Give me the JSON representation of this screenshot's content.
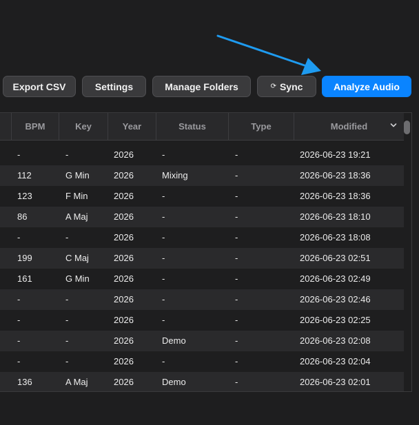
{
  "toolbar": {
    "export_csv": "Export CSV",
    "settings": "Settings",
    "manage_folders": "Manage Folders",
    "sync_icon": "⟳",
    "sync": "Sync",
    "analyze_audio": "Analyze Audio"
  },
  "table": {
    "columns": [
      "BPM",
      "Key",
      "Year",
      "Status",
      "Type",
      "Modified"
    ],
    "sort_icon": "chevron-down-icon",
    "rows": [
      {
        "bpm": "-",
        "key": "-",
        "year": "2026",
        "status": "-",
        "type": "-",
        "modified": "2026-06-23 19:21"
      },
      {
        "bpm": "112",
        "key": "G Min",
        "year": "2026",
        "status": "Mixing",
        "type": "-",
        "modified": "2026-06-23 18:36"
      },
      {
        "bpm": "123",
        "key": "F Min",
        "year": "2026",
        "status": "-",
        "type": "-",
        "modified": "2026-06-23 18:36"
      },
      {
        "bpm": "86",
        "key": "A Maj",
        "year": "2026",
        "status": "-",
        "type": "-",
        "modified": "2026-06-23 18:10"
      },
      {
        "bpm": "-",
        "key": "-",
        "year": "2026",
        "status": "-",
        "type": "-",
        "modified": "2026-06-23 18:08"
      },
      {
        "bpm": "199",
        "key": "C Maj",
        "year": "2026",
        "status": "-",
        "type": "-",
        "modified": "2026-06-23 02:51"
      },
      {
        "bpm": "161",
        "key": "G Min",
        "year": "2026",
        "status": "-",
        "type": "-",
        "modified": "2026-06-23 02:49"
      },
      {
        "bpm": "-",
        "key": "-",
        "year": "2026",
        "status": "-",
        "type": "-",
        "modified": "2026-06-23 02:46"
      },
      {
        "bpm": "-",
        "key": "-",
        "year": "2026",
        "status": "-",
        "type": "-",
        "modified": "2026-06-23 02:25"
      },
      {
        "bpm": "-",
        "key": "-",
        "year": "2026",
        "status": "Demo",
        "type": "-",
        "modified": "2026-06-23 02:08"
      },
      {
        "bpm": "-",
        "key": "-",
        "year": "2026",
        "status": "-",
        "type": "-",
        "modified": "2026-06-23 02:04"
      },
      {
        "bpm": "136",
        "key": "A Maj",
        "year": "2026",
        "status": "Demo",
        "type": "-",
        "modified": "2026-06-23 02:01"
      }
    ]
  },
  "colors": {
    "accent": "#0a84ff",
    "annotation_arrow": "#1e9bf0"
  }
}
